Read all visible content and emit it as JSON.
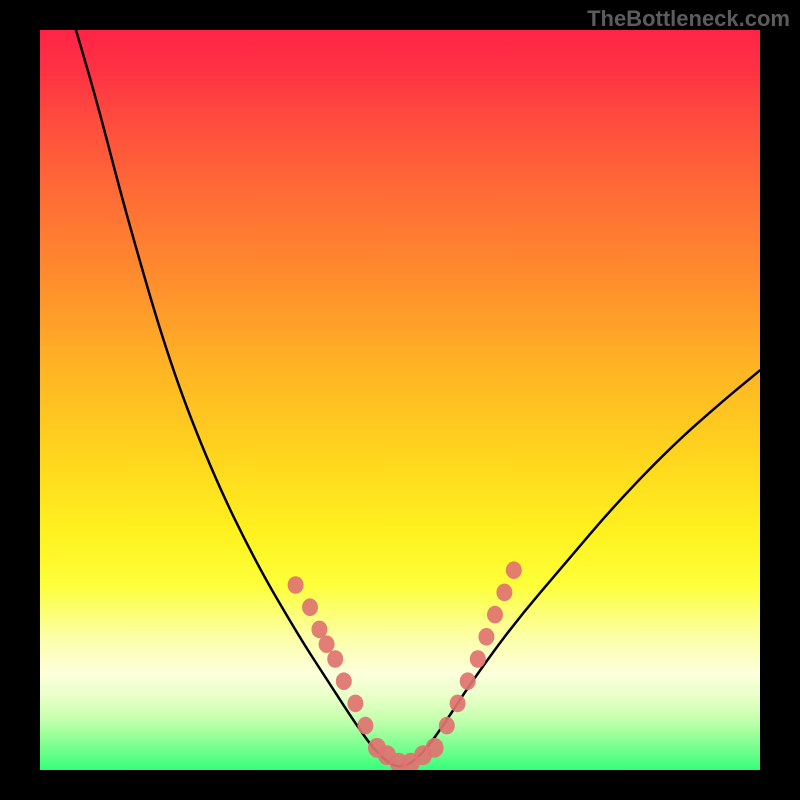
{
  "watermark": "TheBottleneck.com",
  "chart_data": {
    "type": "line",
    "title": "",
    "xlabel": "",
    "ylabel": "",
    "xlim": [
      0,
      1
    ],
    "ylim": [
      0,
      100
    ],
    "series": [
      {
        "name": "curve",
        "x": [
          0.05,
          0.08,
          0.12,
          0.18,
          0.24,
          0.3,
          0.36,
          0.4,
          0.44,
          0.47,
          0.5,
          0.53,
          0.56,
          0.6,
          0.66,
          0.73,
          0.8,
          0.88,
          0.95,
          1.0
        ],
        "y": [
          100,
          90,
          75,
          55,
          40,
          28,
          18,
          12,
          6,
          2,
          0,
          2,
          6,
          12,
          20,
          28,
          36,
          44,
          50,
          54
        ]
      }
    ],
    "markers": {
      "left": [
        {
          "x": 0.355,
          "y": 25
        },
        {
          "x": 0.375,
          "y": 22
        },
        {
          "x": 0.388,
          "y": 19
        },
        {
          "x": 0.398,
          "y": 17
        },
        {
          "x": 0.41,
          "y": 15
        },
        {
          "x": 0.422,
          "y": 12
        },
        {
          "x": 0.438,
          "y": 9
        },
        {
          "x": 0.452,
          "y": 6
        }
      ],
      "bottom": [
        {
          "x": 0.468,
          "y": 3
        },
        {
          "x": 0.482,
          "y": 2
        },
        {
          "x": 0.498,
          "y": 1
        },
        {
          "x": 0.515,
          "y": 1
        },
        {
          "x": 0.532,
          "y": 2
        },
        {
          "x": 0.548,
          "y": 3
        }
      ],
      "right": [
        {
          "x": 0.565,
          "y": 6
        },
        {
          "x": 0.58,
          "y": 9
        },
        {
          "x": 0.594,
          "y": 12
        },
        {
          "x": 0.608,
          "y": 15
        },
        {
          "x": 0.62,
          "y": 18
        },
        {
          "x": 0.632,
          "y": 21
        },
        {
          "x": 0.645,
          "y": 24
        },
        {
          "x": 0.658,
          "y": 27
        }
      ]
    },
    "gradient_stops": [
      {
        "pos": 0,
        "color": "#ff2447"
      },
      {
        "pos": 22,
        "color": "#ff6b36"
      },
      {
        "pos": 46,
        "color": "#ffb524"
      },
      {
        "pos": 68,
        "color": "#fff21f"
      },
      {
        "pos": 87,
        "color": "#fdffdc"
      },
      {
        "pos": 100,
        "color": "#36ff7a"
      }
    ]
  }
}
